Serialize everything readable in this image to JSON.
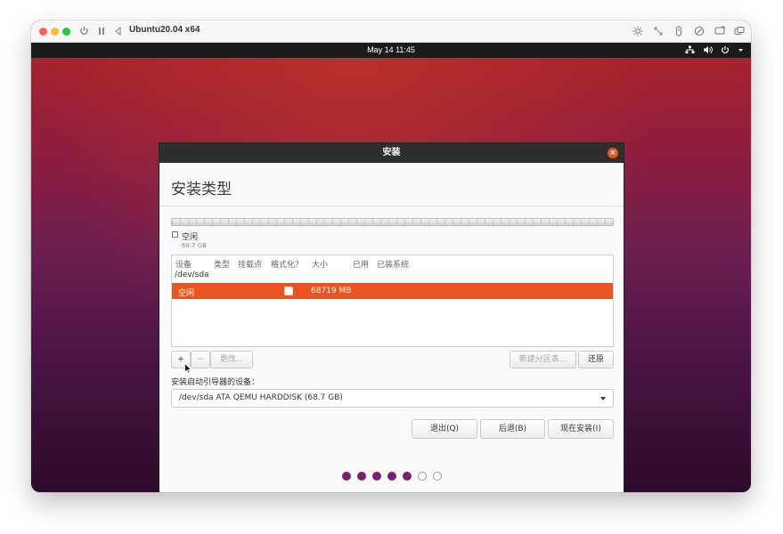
{
  "vm": {
    "title": "Ubuntu20.04 x64",
    "controls": [
      "power-icon",
      "pause-icon",
      "back-icon"
    ],
    "toolbar_icons": [
      "brightness-icon",
      "resize-icon",
      "usb-icon",
      "disc-icon",
      "display-icon",
      "windows-icon"
    ]
  },
  "topbar": {
    "clock": "May 14  11:45",
    "tray_icons": [
      "network-icon",
      "volume-icon",
      "power-icon",
      "chevron-down-icon"
    ]
  },
  "dialog": {
    "title": "安装",
    "heading": "安装类型",
    "legend": {
      "label": "空闲",
      "size": "68.7 GB"
    },
    "table": {
      "columns": [
        "设备",
        "类型",
        "挂载点",
        "格式化？",
        "大小",
        "已用",
        "已装系统"
      ],
      "device": "/dev/sda",
      "rows": [
        {
          "device": "空闲",
          "type": "",
          "mount": "",
          "format": false,
          "size": "68719 MB",
          "used": "",
          "system": ""
        }
      ]
    },
    "buttons": {
      "add": "+",
      "remove": "−",
      "change": "更改...",
      "new_table": "新建分区表...",
      "revert": "还原",
      "quit": "退出(Q)",
      "back": "后退(B)",
      "install": "现在安装(I)"
    },
    "boot_label": "安装启动引导器的设备：",
    "boot_device": "/dev/sda ATA QEMU HARDDISK (68.7 GB)",
    "progress": {
      "total_steps": 7,
      "completed_steps": 5
    }
  },
  "colors": {
    "accent": "#e95420",
    "progress": "#77216f",
    "topbar": "#1b1b1b"
  }
}
